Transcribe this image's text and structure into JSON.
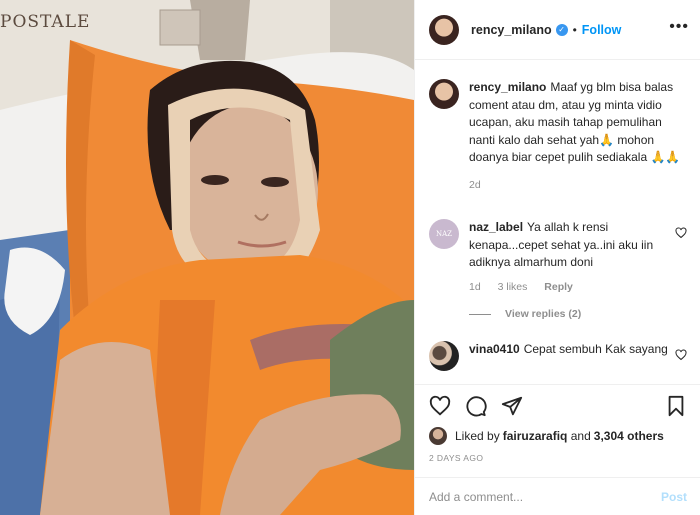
{
  "post_owner": {
    "username": "rency_milano",
    "verified": true,
    "follow_label": "Follow",
    "separator": "•",
    "more_label": "•••"
  },
  "photo": {
    "background_text": "POSTALE",
    "description_icon": "photo"
  },
  "caption": {
    "username": "rency_milano",
    "text": "Maaf yg blm bisa balas coment atau dm, atau yg minta vidio ucapan, aku masih tahap pemulihan nanti kalo dah sehat yah🙏 mohon doanya biar cepet pulih sediakala 🙏🙏",
    "age": "2d"
  },
  "comments": [
    {
      "username": "naz_label",
      "avatar_text": "NAZ",
      "text": "Ya allah k rensi kenapa...cepet sehat ya..ini aku iin adiknya almarhum doni",
      "age": "1d",
      "likes": "3 likes",
      "reply_label": "Reply",
      "view_replies": "View replies (2)"
    },
    {
      "username": "vina0410",
      "text": "Cepat sembuh Kak sayang"
    }
  ],
  "actions": {
    "liked_by_prefix": "Liked by",
    "liked_by_user": "fairuzarafiq",
    "liked_by_and": "and",
    "liked_by_count": "3,304 others",
    "time": "2 DAYS AGO"
  },
  "add_comment": {
    "placeholder": "Add a comment...",
    "post_label": "Post"
  },
  "colors": {
    "link_blue": "#0095f6",
    "verified_blue": "#3897f0",
    "muted": "#8e8e8e",
    "post_disabled": "#b2dffc"
  }
}
